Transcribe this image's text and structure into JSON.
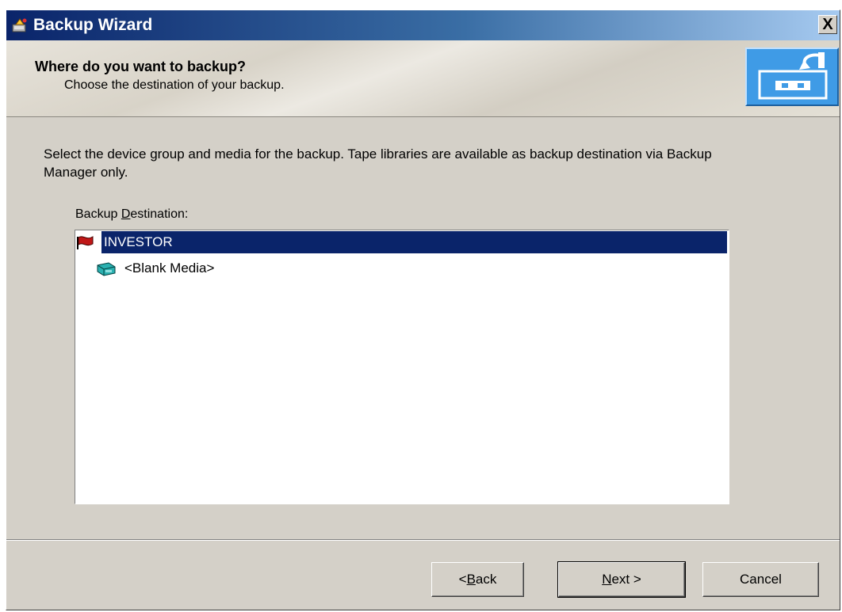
{
  "window": {
    "title": "Backup Wizard",
    "close_glyph": "X",
    "title_icon": "backup-wizard-icon"
  },
  "header": {
    "title": "Where do you want to backup?",
    "subtitle": "Choose the destination of your backup.",
    "image": "tape-backup-graphic"
  },
  "instructions": "Select the device group and media for the backup. Tape libraries are available as backup destination via Backup Manager only.",
  "destination": {
    "label_prefix": "Backup ",
    "label_mnemonic": "D",
    "label_suffix": "estination:",
    "items": [
      {
        "label": "INVESTOR",
        "icon": "device-group-flag-icon",
        "selected": true
      },
      {
        "label": "<Blank Media>",
        "icon": "media-cartridge-icon",
        "selected": false
      }
    ]
  },
  "buttons": {
    "back": {
      "prefix": "< ",
      "mnemonic": "B",
      "suffix": "ack"
    },
    "next": {
      "prefix": "",
      "mnemonic": "N",
      "suffix": "ext >"
    },
    "cancel": "Cancel"
  },
  "colors": {
    "title_gradient_start": "#0a246a",
    "title_gradient_end": "#a6caf0",
    "selection": "#0a246a",
    "dialog_face": "#d4d0c8"
  }
}
